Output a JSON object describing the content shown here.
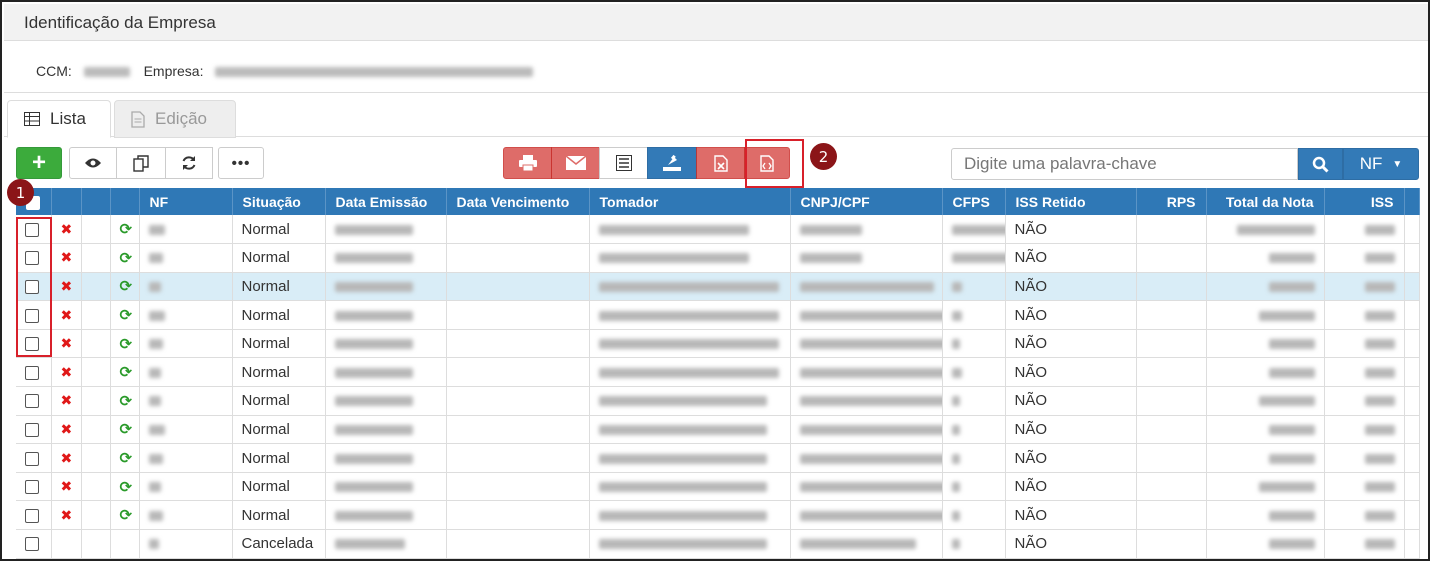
{
  "panel": {
    "title": "Identificação da Empresa"
  },
  "info": {
    "ccm_label": "CCM:",
    "empresa_label": "Empresa:"
  },
  "tabs": [
    {
      "label": "Lista",
      "icon": "table-icon",
      "active": true
    },
    {
      "label": "Edição",
      "icon": "document-icon",
      "active": false
    }
  ],
  "toolbar": {
    "add_icon": "plus-icon",
    "group_icons": [
      "eye-icon",
      "copy-icon",
      "refresh-icon",
      "more-icon"
    ],
    "export_icons": [
      "print-icon",
      "email-icon",
      "list-icon",
      "export-icon",
      "excel-icon",
      "xml-icon"
    ],
    "search_placeholder": "Digite uma palavra-chave",
    "search_icon": "search-icon",
    "dropdown_label": "NF"
  },
  "annotations": {
    "badge_1": "1",
    "badge_2": "2"
  },
  "colors": {
    "header_blue": "#2f78b6",
    "add_green": "#3cab3c",
    "export_red": "#d9534f",
    "highlight_row": "#d9edf7",
    "annotation_red": "#d8202a"
  },
  "table": {
    "columns": [
      "NF",
      "Situação",
      "Data Emissão",
      "Data Vencimento",
      "Tomador",
      "CNPJ/CPF",
      "CFPS",
      "ISS Retido",
      "RPS",
      "Total da Nota",
      "ISS"
    ],
    "rows": [
      {
        "situacao": "Normal",
        "iss_retido": "NÃO",
        "actions": true,
        "highlight": false
      },
      {
        "situacao": "Normal",
        "iss_retido": "NÃO",
        "actions": true,
        "highlight": false
      },
      {
        "situacao": "Normal",
        "iss_retido": "NÃO",
        "actions": true,
        "highlight": true
      },
      {
        "situacao": "Normal",
        "iss_retido": "NÃO",
        "actions": true,
        "highlight": false
      },
      {
        "situacao": "Normal",
        "iss_retido": "NÃO",
        "actions": true,
        "highlight": false
      },
      {
        "situacao": "Normal",
        "iss_retido": "NÃO",
        "actions": true,
        "highlight": false
      },
      {
        "situacao": "Normal",
        "iss_retido": "NÃO",
        "actions": true,
        "highlight": false
      },
      {
        "situacao": "Normal",
        "iss_retido": "NÃO",
        "actions": true,
        "highlight": false
      },
      {
        "situacao": "Normal",
        "iss_retido": "NÃO",
        "actions": true,
        "highlight": false
      },
      {
        "situacao": "Normal",
        "iss_retido": "NÃO",
        "actions": true,
        "highlight": false
      },
      {
        "situacao": "Normal",
        "iss_retido": "NÃO",
        "actions": true,
        "highlight": false
      },
      {
        "situacao": "Cancelada",
        "iss_retido": "NÃO",
        "actions": false,
        "highlight": false
      }
    ]
  }
}
